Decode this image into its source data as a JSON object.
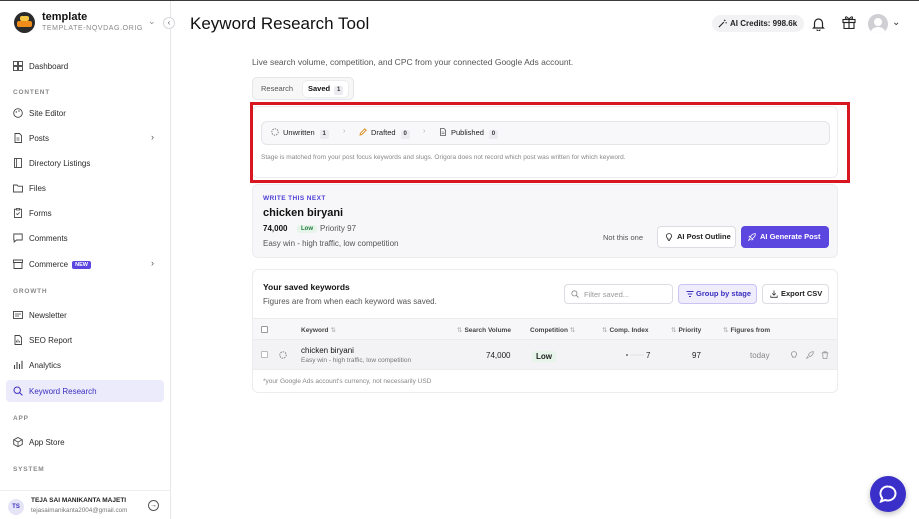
{
  "workspace": {
    "name": "template",
    "slug": "TEMPLATE-NQVDAG.ORIGOR..."
  },
  "sidebar": {
    "items": [
      {
        "label": "Dashboard"
      },
      {
        "label": "Site Editor"
      },
      {
        "label": "Posts"
      },
      {
        "label": "Directory Listings"
      },
      {
        "label": "Files"
      },
      {
        "label": "Forms"
      },
      {
        "label": "Comments"
      },
      {
        "label": "Commerce",
        "badge": "NEW"
      },
      {
        "label": "Newsletter"
      },
      {
        "label": "SEO Report"
      },
      {
        "label": "Analytics"
      },
      {
        "label": "Keyword Research",
        "active": true
      },
      {
        "label": "App Store"
      }
    ],
    "sections": {
      "content": "CONTENT",
      "growth": "GROWTH",
      "app": "APP",
      "system": "SYSTEM"
    }
  },
  "user": {
    "initials": "TS",
    "name": "TEJA SAI MANIKANTA MAJETI",
    "email": "tejasaimanikanta2004@gmail.com"
  },
  "header": {
    "title": "Keyword Research Tool",
    "credits": "AI Credits: 998.6k"
  },
  "subtitle": "Live search volume, competition, and CPC from your connected Google Ads account.",
  "tabs": [
    {
      "label": "Research"
    },
    {
      "label": "Saved",
      "count": "1"
    }
  ],
  "stages": {
    "unwritten": {
      "label": "Unwritten",
      "count": "1"
    },
    "drafted": {
      "label": "Drafted",
      "count": "0"
    },
    "published": {
      "label": "Published",
      "count": "0"
    },
    "note": "Stage is matched from your post focus keywords and slugs. Origora does not record which post was written for which keyword."
  },
  "next": {
    "kicker": "WRITE THIS NEXT",
    "keyword": "chicken biryani",
    "volume": "74,000",
    "competition": "Low",
    "priority": "Priority 97",
    "description": "Easy win - high traffic, low competition",
    "not_this_one": "Not this one",
    "outline_button": "AI Post Outline",
    "generate_button": "AI Generate Post"
  },
  "saved": {
    "title": "Your saved keywords",
    "subtitle": "Figures are from when each keyword was saved.",
    "filter_placeholder": "Filter saved...",
    "group_button": "Group by stage",
    "export_button": "Export CSV",
    "columns": {
      "keyword": "Keyword",
      "volume": "Search Volume",
      "competition": "Competition",
      "comp_index": "Comp. Index",
      "priority": "Priority",
      "figures_from": "Figures from"
    },
    "rows": [
      {
        "keyword": "chicken biryani",
        "description": "Easy win - high traffic, low competition",
        "volume": "74,000",
        "competition": "Low",
        "comp_index": "7",
        "priority": "97",
        "figures_from": "today"
      }
    ],
    "footnote": "*your Google Ads account's currency, not necessarily USD"
  },
  "colors": {
    "accent": "#5b47e0",
    "highlight": "#d8161f",
    "low_green": "#1f7a3d"
  }
}
